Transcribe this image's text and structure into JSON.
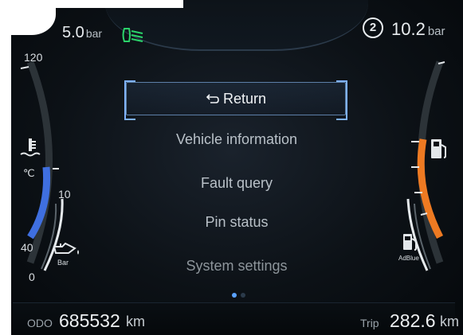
{
  "header": {
    "left_value": "5.0",
    "left_unit": "bar",
    "gear_indicator": "2",
    "right_value": "10.2",
    "right_unit": "bar",
    "beam_icon": "headlight-beam-icon",
    "beam_color": "#2bd36a"
  },
  "left_gauge": {
    "tick_top": "120",
    "tick_mid": "10",
    "tick_low": "40",
    "tick_bottom": "0",
    "temp_unit": "℃",
    "temp_icon": "coolant-temperature-icon",
    "oil_icon": "oil-pressure-icon",
    "oil_label": "Bar",
    "coolant_level_color": "#3f6fe0"
  },
  "right_gauge": {
    "fuel_icon": "fuel-pump-icon",
    "adblue_icon": "adblue-pump-icon",
    "adblue_label": "AdBlue",
    "fuel_level_color": "#ee7a22"
  },
  "menu": {
    "selected": "Return",
    "return_icon": "return-arrow-icon",
    "items": [
      "Vehicle information",
      "Fault query",
      "Pin status",
      "System settings"
    ],
    "page_dots": 2,
    "active_dot": 0
  },
  "footer": {
    "odo_label": "ODO",
    "odo_value": "685532",
    "odo_unit": "km",
    "trip_label": "Trip",
    "trip_value": "282.6",
    "trip_unit": "km"
  }
}
